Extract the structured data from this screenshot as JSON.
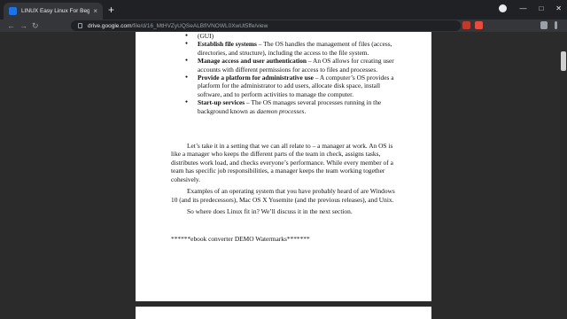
{
  "browser": {
    "tab_title": "LINUX Easy Linux For Beginners,",
    "tab_close": "×",
    "new_tab": "+",
    "url_domain": "drive.google.com",
    "url_path": "/file/d/16_MtHVZyUQSeALBfIVNOWL0XwUt5ffe/view",
    "back": "←",
    "forward": "→",
    "reload": "↻"
  },
  "document": {
    "top_fragment": "(GUI)",
    "bullets": [
      {
        "term": "Establish file systems",
        "text": " – The OS handles the management of files (access, directories, and structure), including the access to the file system."
      },
      {
        "term": "Manage access and user authentication",
        "text": " – An OS allows for creating user accounts with different permissions for access to files and processes."
      },
      {
        "term": "Provide a platform for administrative use",
        "text": " – A computer’s OS provides a platform for the administrator to add users, allocate disk space, install software, and to perform activities to manage the computer."
      },
      {
        "term": "Start-up services",
        "text": " – The OS manages several processes running in the background known as ",
        "emph": "daemon processes",
        "end": "."
      }
    ],
    "para1": "Let’s take it in  a setting that we can all relate to – a manager at work. An OS is like a manager who keeps the different parts of the team in check, assigns tasks, distributes work load, and checks everyone’s performance. While every member of a team has specific job responsibilities, a manager keeps the team working together cohesively.",
    "para2": "Examples of an operating system that you have probably heard of are Windows 10 (and its predecessors), Mac OS X Yosemite (and the previous releases), and Unix.",
    "para3": "So where does Linux fit in? We’ll discuss it in the next section.",
    "watermark": "******ebook converter DEMO Watermarks*******"
  },
  "colors": {
    "tab_bar": "#202124",
    "toolbar": "#35363a",
    "viewer_bg": "#2b2b2b",
    "page_bg": "#ffffff"
  }
}
